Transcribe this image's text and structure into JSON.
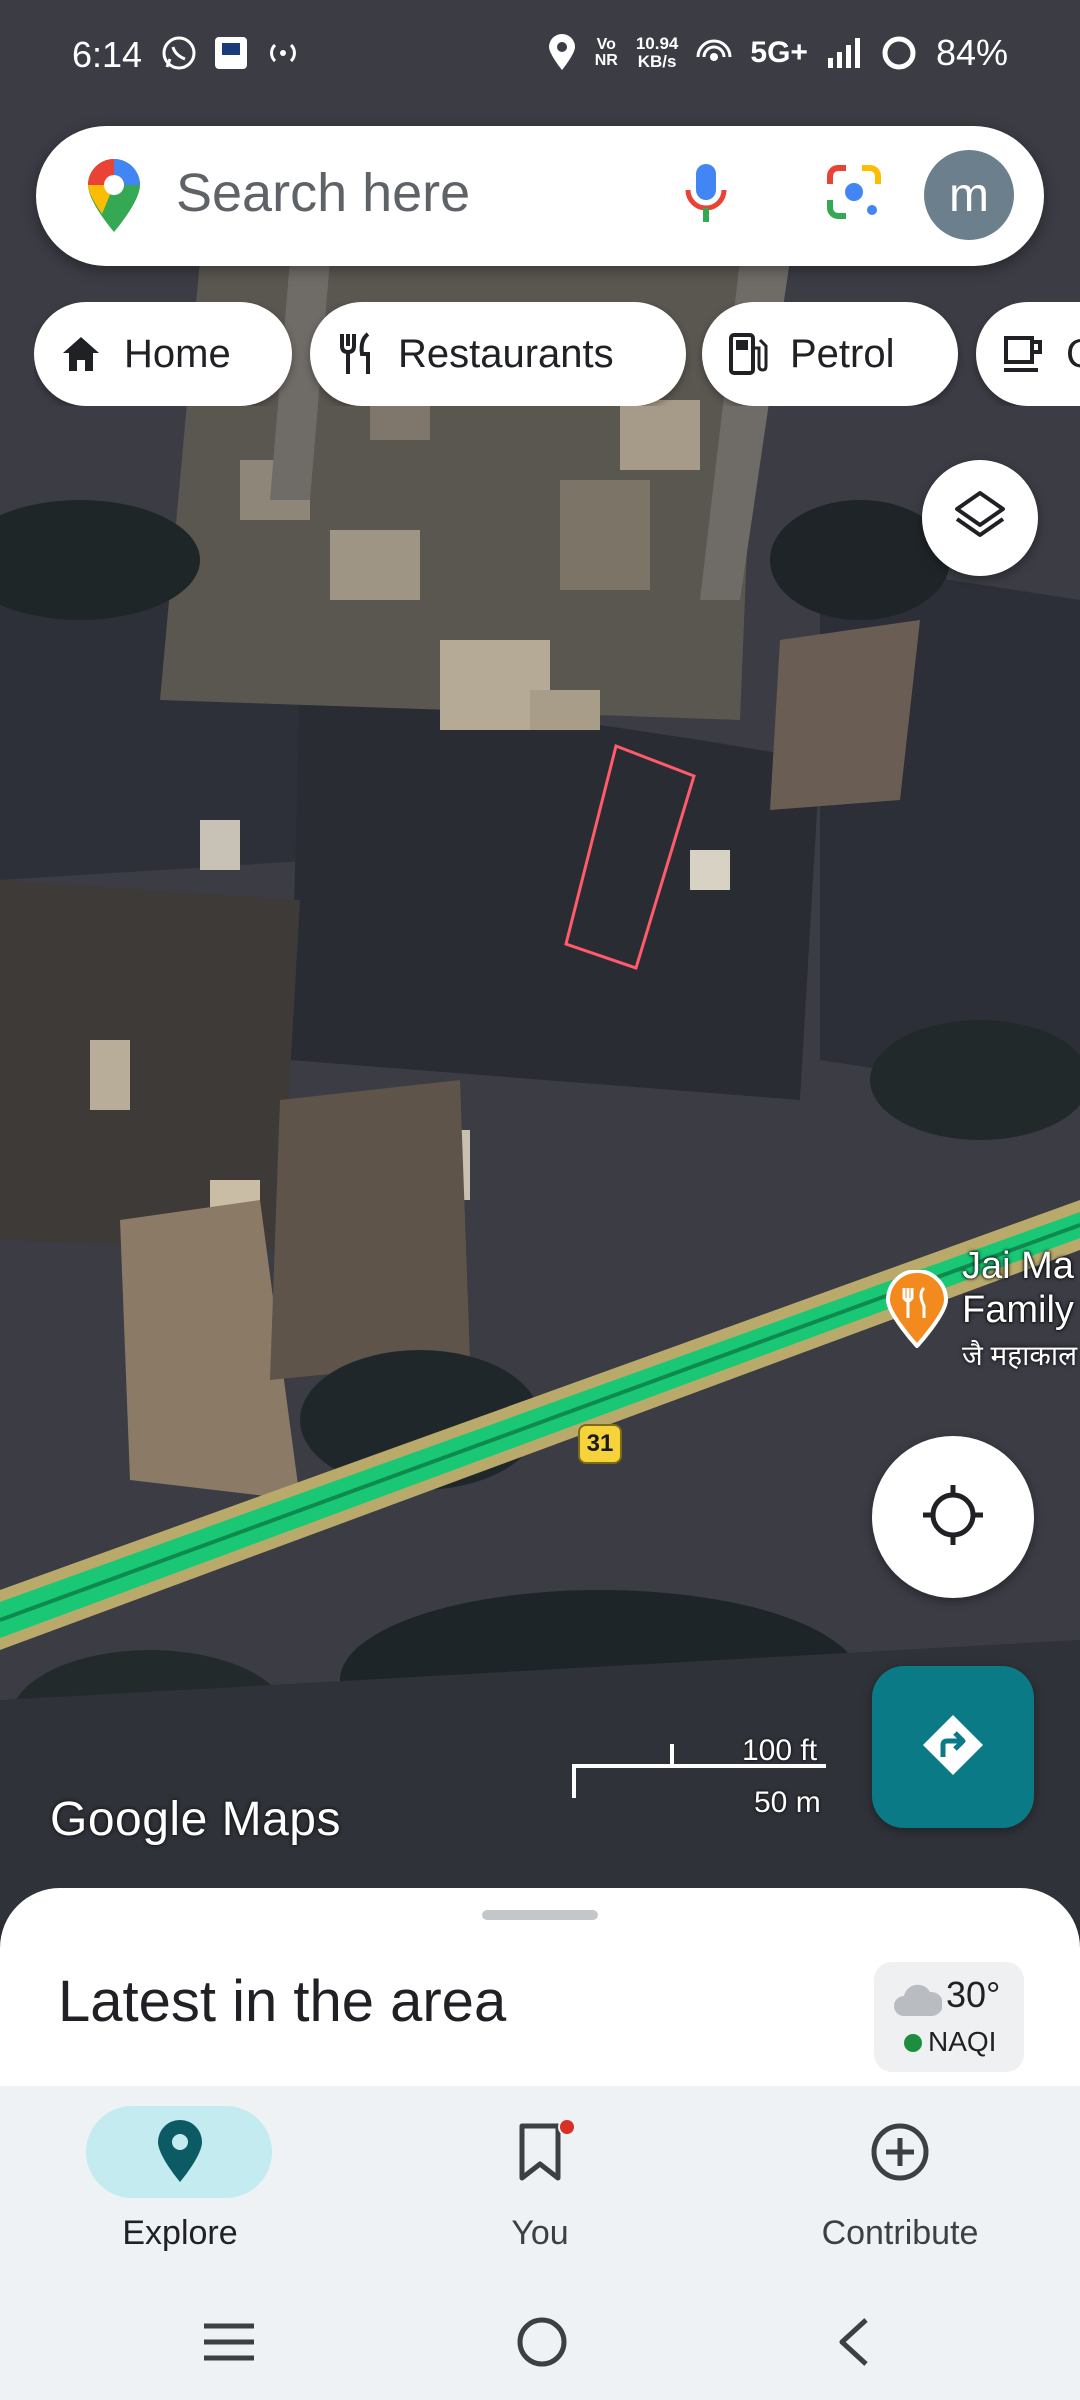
{
  "status_bar": {
    "time": "6:14",
    "net_speed_value": "10.94",
    "net_speed_unit": "KB/s",
    "vo": "Vo",
    "nr": "NR",
    "network": "5G+",
    "battery": "84%"
  },
  "search": {
    "placeholder": "Search here",
    "avatar_letter": "m"
  },
  "chips": [
    {
      "label": "Home",
      "icon": "home-icon"
    },
    {
      "label": "Restaurants",
      "icon": "restaurant-icon"
    },
    {
      "label": "Petrol",
      "icon": "fuel-icon"
    },
    {
      "label": "C",
      "icon": "coffee-icon"
    }
  ],
  "map": {
    "place_name_line1": "Jai Ma",
    "place_name_line2": "Family",
    "place_name_hindi": "जै महाकाल",
    "route_number": "31",
    "logo": "Google Maps",
    "scale_ft": "100 ft",
    "scale_m": "50 m"
  },
  "sheet": {
    "title": "Latest in the area",
    "temperature": "30°",
    "aqi_label": "NAQI"
  },
  "bottom_nav": {
    "items": [
      {
        "label": "Explore",
        "icon": "explore-pin-icon",
        "active": true
      },
      {
        "label": "You",
        "icon": "bookmark-icon",
        "active": false
      },
      {
        "label": "Contribute",
        "icon": "add-circle-icon",
        "active": false
      }
    ]
  },
  "colors": {
    "accent_teal": "#0b7a87",
    "explore_pill": "#c4ebf0",
    "road_green": "#19c775",
    "restaurant_pin": "#f28a1e",
    "plot_outline": "#ff5b6b"
  }
}
